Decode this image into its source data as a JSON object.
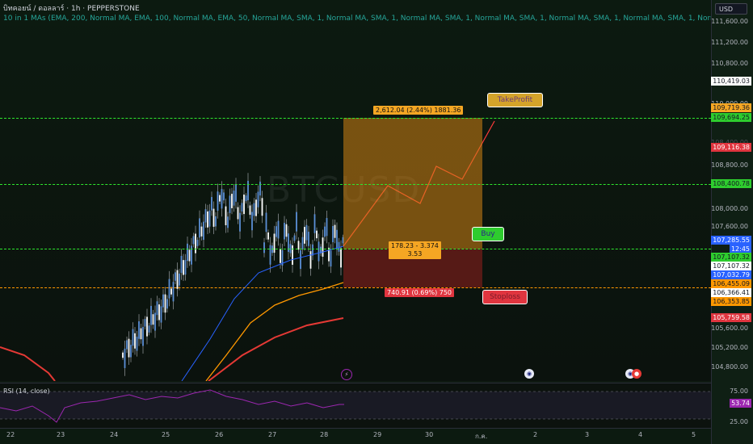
{
  "legend": {
    "symbol_line": "บิทคอยน์ / ดอลลาร์ · 1h · PEPPERSTONE",
    "ma_line": "10 in 1 MAs (EMA, 200, Normal MA, EMA, 100, Normal MA, EMA, 50, Normal MA, SMA, 1, Normal MA, SMA, 1, Normal MA, SMA, 1, Normal MA, SMA, 1, Normal MA, SMA, 1, Normal MA, SMA, 1, Normal MA"
  },
  "watermark": "BTCUSD",
  "currency": "USD",
  "position": {
    "target_label": "2,612.04 (2.44%) 1881.36",
    "entry_label_line1": "178.23 - 3.374",
    "entry_label_line2": "3.53",
    "stop_label": "740.91 (0.69%) 750"
  },
  "callouts": {
    "take_profit": "TakeProfit",
    "buy": "Buy",
    "stop_loss": "Stoploss"
  },
  "price_axis": {
    "grid": [
      "111,600.00",
      "111,200.00",
      "110,800.00",
      "110,000.00",
      "108,800.00",
      "108,000.00",
      "107,600.00",
      "105,600.00",
      "105,200.00",
      "104,800.00"
    ],
    "faded_tag": "108,400.00",
    "tags": [
      {
        "value": "110,419.03",
        "bg": "#ffffff",
        "fg": "#131722"
      },
      {
        "value": "109,719.36",
        "bg": "#f5a623",
        "fg": "#131722"
      },
      {
        "value": "109,694.25",
        "bg": "#2ecc2e",
        "fg": "#131722"
      },
      {
        "value": "109,116.38",
        "bg": "#e0353f",
        "fg": "#ffffff"
      },
      {
        "value": "108,400.78",
        "bg": "#2ecc2e",
        "fg": "#131722"
      },
      {
        "value": "107,285.55",
        "bg": "#2962ff",
        "fg": "#ffffff"
      },
      {
        "value": "12:45",
        "bg": "#2962ff",
        "fg": "#ffffff"
      },
      {
        "value": "107,107.32",
        "bg": "#2ecc2e",
        "fg": "#131722"
      },
      {
        "value": "107,107.32",
        "bg": "#ffffff",
        "fg": "#131722"
      },
      {
        "value": "107,032.79",
        "bg": "#2962ff",
        "fg": "#ffffff"
      },
      {
        "value": "106,455.09",
        "bg": "#ff9800",
        "fg": "#131722"
      },
      {
        "value": "106,366.41",
        "bg": "#ffffff",
        "fg": "#131722"
      },
      {
        "value": "106,353.85",
        "bg": "#ff9800",
        "fg": "#131722"
      },
      {
        "value": "105,759.58",
        "bg": "#e0353f",
        "fg": "#ffffff"
      }
    ]
  },
  "rsi": {
    "legend": "RSI (14, close)",
    "value": "53.74",
    "axis_75": "75.00",
    "axis_25": "25.00"
  },
  "time_axis": [
    "22",
    "23",
    "24",
    "25",
    "26",
    "27",
    "28",
    "29",
    "30",
    "ก.ค.",
    "2",
    "3",
    "4",
    "5"
  ],
  "colors": {
    "tp_line": "#2ee82e",
    "sl_line": "#ff9800",
    "candle": "#5b8fd6",
    "ema200": "#e53935",
    "ema100": "#ff9800",
    "ema50": "#2962ff",
    "rsi": "#9c27b0"
  }
}
